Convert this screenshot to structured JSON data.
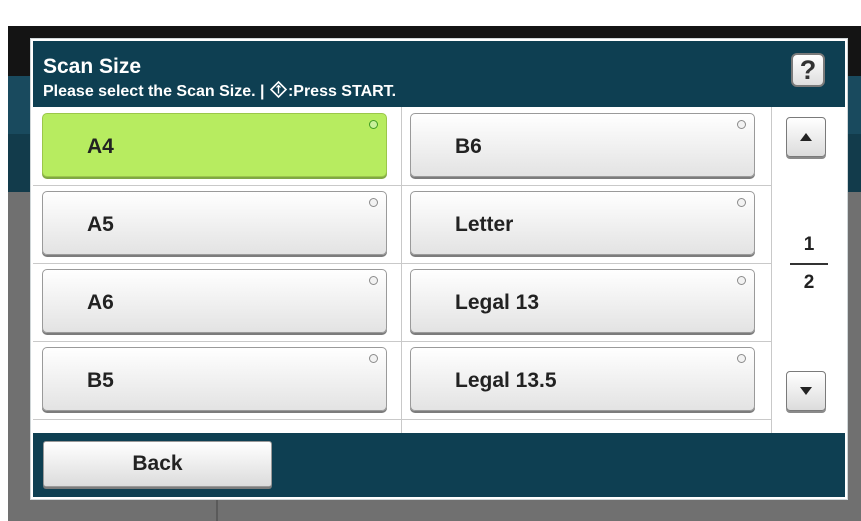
{
  "dialog": {
    "title": "Scan Size",
    "instruction_prefix": "Please select the Scan Size. | ",
    "instruction_suffix": ":Press START.",
    "help_label": "?"
  },
  "sizes": {
    "selected": "A4",
    "items": [
      {
        "label": "A4",
        "selected": true
      },
      {
        "label": "A5",
        "selected": false
      },
      {
        "label": "A6",
        "selected": false
      },
      {
        "label": "B5",
        "selected": false
      },
      {
        "label": "B6",
        "selected": false
      },
      {
        "label": "Letter",
        "selected": false
      },
      {
        "label": "Legal 13",
        "selected": false
      },
      {
        "label": "Legal 13.5",
        "selected": false
      }
    ]
  },
  "pager": {
    "current": "1",
    "total": "2"
  },
  "footer": {
    "back_label": "Back"
  },
  "colors": {
    "header_bg": "#0e3f52",
    "selected_bg": "#b7ec60",
    "selected_radio": "#3f9b23"
  },
  "icons": {
    "start": "start-diamond-icon",
    "help": "help-icon",
    "up": "arrow-up-icon",
    "down": "arrow-down-icon",
    "radio": "radio-indicator-icon"
  }
}
